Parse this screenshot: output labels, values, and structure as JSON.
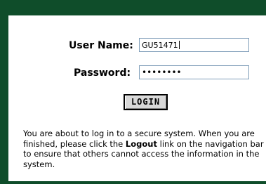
{
  "colors": {
    "frame_background": "#0f4d2a",
    "panel_background": "#ffffff",
    "input_border": "#7f9db9"
  },
  "form": {
    "username_label": "User Name:",
    "username_value": "GU51471",
    "password_label": "Password:",
    "password_mask": "••••••••",
    "login_button_label": "LOGIN"
  },
  "notice": {
    "text_before": "You are about to log in to a secure system. When you are finished, please click the ",
    "logout_link_label": "Logout",
    "text_after": " link on the navigation bar to ensure that others cannot access the information in the system."
  }
}
